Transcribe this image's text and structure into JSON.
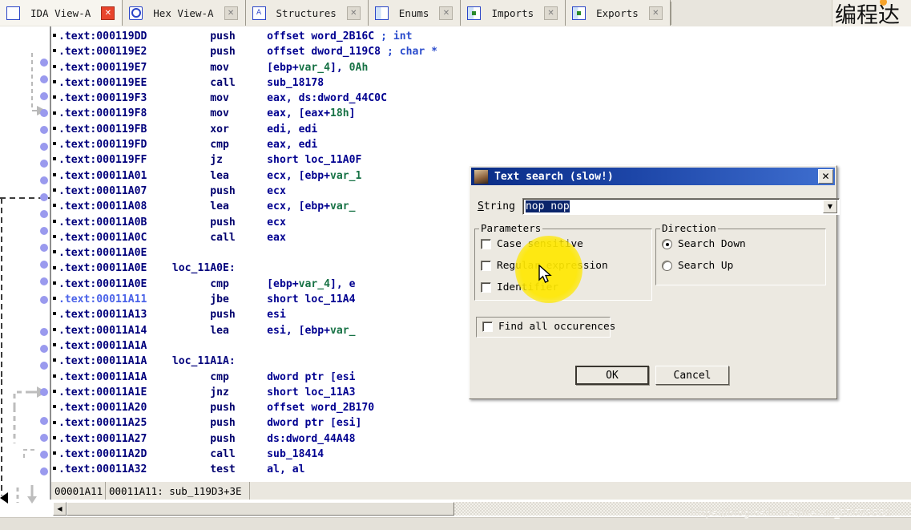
{
  "window": {
    "chinese_overlay": "编程达"
  },
  "tabs": [
    {
      "label": "IDA View-A",
      "icon": "ida-view-icon",
      "active": true,
      "close": "✕"
    },
    {
      "label": "Hex View-A",
      "icon": "hex-view-icon",
      "active": false,
      "close": "✕"
    },
    {
      "label": "Structures",
      "icon": "structures-icon",
      "active": false,
      "close": "✕"
    },
    {
      "label": "Enums",
      "icon": "enums-icon",
      "active": false,
      "close": "✕"
    },
    {
      "label": "Imports",
      "icon": "imports-icon",
      "active": false,
      "close": "✕"
    },
    {
      "label": "Exports",
      "icon": "exports-icon",
      "active": false,
      "close": "✕"
    }
  ],
  "disassembly": {
    "segment": ".text",
    "lines": [
      {
        "addr": "000119DD",
        "label": "",
        "mnemonic": "push",
        "operands": "offset word_2B16C",
        "comment": "; int"
      },
      {
        "addr": "000119E2",
        "label": "",
        "mnemonic": "push",
        "operands": "offset dword_119C8",
        "comment": "; char *"
      },
      {
        "addr": "000119E7",
        "label": "",
        "mnemonic": "mov",
        "operands": "[ebp+var_4], 0Ah",
        "comment": ""
      },
      {
        "addr": "000119EE",
        "label": "",
        "mnemonic": "call",
        "operands": "sub_18178",
        "comment": ""
      },
      {
        "addr": "000119F3",
        "label": "",
        "mnemonic": "mov",
        "operands": "eax, ds:dword_44C0C",
        "comment": ""
      },
      {
        "addr": "000119F8",
        "label": "",
        "mnemonic": "mov",
        "operands": "eax, [eax+18h]",
        "comment": ""
      },
      {
        "addr": "000119FB",
        "label": "",
        "mnemonic": "xor",
        "operands": "edi, edi",
        "comment": ""
      },
      {
        "addr": "000119FD",
        "label": "",
        "mnemonic": "cmp",
        "operands": "eax, edi",
        "comment": ""
      },
      {
        "addr": "000119FF",
        "label": "",
        "mnemonic": "jz",
        "operands": "short loc_11A0F",
        "comment": ""
      },
      {
        "addr": "00011A01",
        "label": "",
        "mnemonic": "lea",
        "operands": "ecx, [ebp+var_1",
        "comment": ""
      },
      {
        "addr": "00011A07",
        "label": "",
        "mnemonic": "push",
        "operands": "ecx",
        "comment": ""
      },
      {
        "addr": "00011A08",
        "label": "",
        "mnemonic": "lea",
        "operands": "ecx, [ebp+var_",
        "comment": ""
      },
      {
        "addr": "00011A0B",
        "label": "",
        "mnemonic": "push",
        "operands": "ecx",
        "comment": ""
      },
      {
        "addr": "00011A0C",
        "label": "",
        "mnemonic": "call",
        "operands": "eax",
        "comment": ""
      },
      {
        "addr": "00011A0E",
        "label": "",
        "mnemonic": "",
        "operands": "",
        "comment": ""
      },
      {
        "addr": "00011A0E",
        "label": "loc_11A0E:",
        "mnemonic": "",
        "operands": "",
        "comment": ""
      },
      {
        "addr": "00011A0E",
        "label": "",
        "mnemonic": "cmp",
        "operands": "[ebp+var_4], e",
        "comment": ""
      },
      {
        "addr": "00011A11",
        "label": "",
        "mnemonic": "jbe",
        "operands": "short loc_11A4",
        "comment": "",
        "current": true
      },
      {
        "addr": "00011A13",
        "label": "",
        "mnemonic": "push",
        "operands": "esi",
        "comment": ""
      },
      {
        "addr": "00011A14",
        "label": "",
        "mnemonic": "lea",
        "operands": "esi, [ebp+var_",
        "comment": ""
      },
      {
        "addr": "00011A1A",
        "label": "",
        "mnemonic": "",
        "operands": "",
        "comment": ""
      },
      {
        "addr": "00011A1A",
        "label": "loc_11A1A:",
        "mnemonic": "",
        "operands": "",
        "comment": ""
      },
      {
        "addr": "00011A1A",
        "label": "",
        "mnemonic": "cmp",
        "operands": "dword ptr [esi",
        "comment": ""
      },
      {
        "addr": "00011A1E",
        "label": "",
        "mnemonic": "jnz",
        "operands": "short loc_11A3",
        "comment": ""
      },
      {
        "addr": "00011A20",
        "label": "",
        "mnemonic": "push",
        "operands": "offset word_2B170",
        "comment": ""
      },
      {
        "addr": "00011A25",
        "label": "",
        "mnemonic": "push",
        "operands": "dword ptr [esi]",
        "comment": ""
      },
      {
        "addr": "00011A27",
        "label": "",
        "mnemonic": "push",
        "operands": "ds:dword_44A48",
        "comment": ""
      },
      {
        "addr": "00011A2D",
        "label": "",
        "mnemonic": "call",
        "operands": "sub_18414",
        "comment": ""
      },
      {
        "addr": "00011A32",
        "label": "",
        "mnemonic": "test",
        "operands": "al, al",
        "comment": ""
      }
    ]
  },
  "statusbar": {
    "offset": "00001A11",
    "location": "00011A11: sub_119D3+3E",
    "extra": ""
  },
  "scrollbar": {
    "left_arrow": "◀",
    "right_arrow": "▶"
  },
  "dialog": {
    "title": "Text search (slow!)",
    "close_label": "✕",
    "string": {
      "label": "String",
      "label_accel": "S",
      "value": "nop nop",
      "placeholder": "",
      "dropdown_arrow": "▼"
    },
    "parameters": {
      "title": "Parameters",
      "items": [
        {
          "label": "Case sensitive",
          "checked": false
        },
        {
          "label": "Regular expression",
          "checked": false
        },
        {
          "label": "Identifier",
          "checked": false
        }
      ]
    },
    "direction": {
      "title": "Direction",
      "items": [
        {
          "label": "Search Down",
          "selected": true
        },
        {
          "label": "Search Up",
          "selected": false
        }
      ]
    },
    "find_all": {
      "label": "Find all occurences",
      "checked": false
    },
    "buttons": {
      "ok": "OK",
      "cancel": "Cancel"
    }
  },
  "watermark": {
    "text": "https://blog.csdn.net/weixin_37673331"
  },
  "colors": {
    "title_bar_blue": "#0a2c86",
    "dialog_face": "#ece9e1",
    "code_blue": "#00008b",
    "code_green": "#177245",
    "selection_blue": "#0a246a",
    "tab_close_active": "#e8442c",
    "flow_dot_purple": "#9a9aee",
    "cursor_glow": "#ffe800"
  }
}
